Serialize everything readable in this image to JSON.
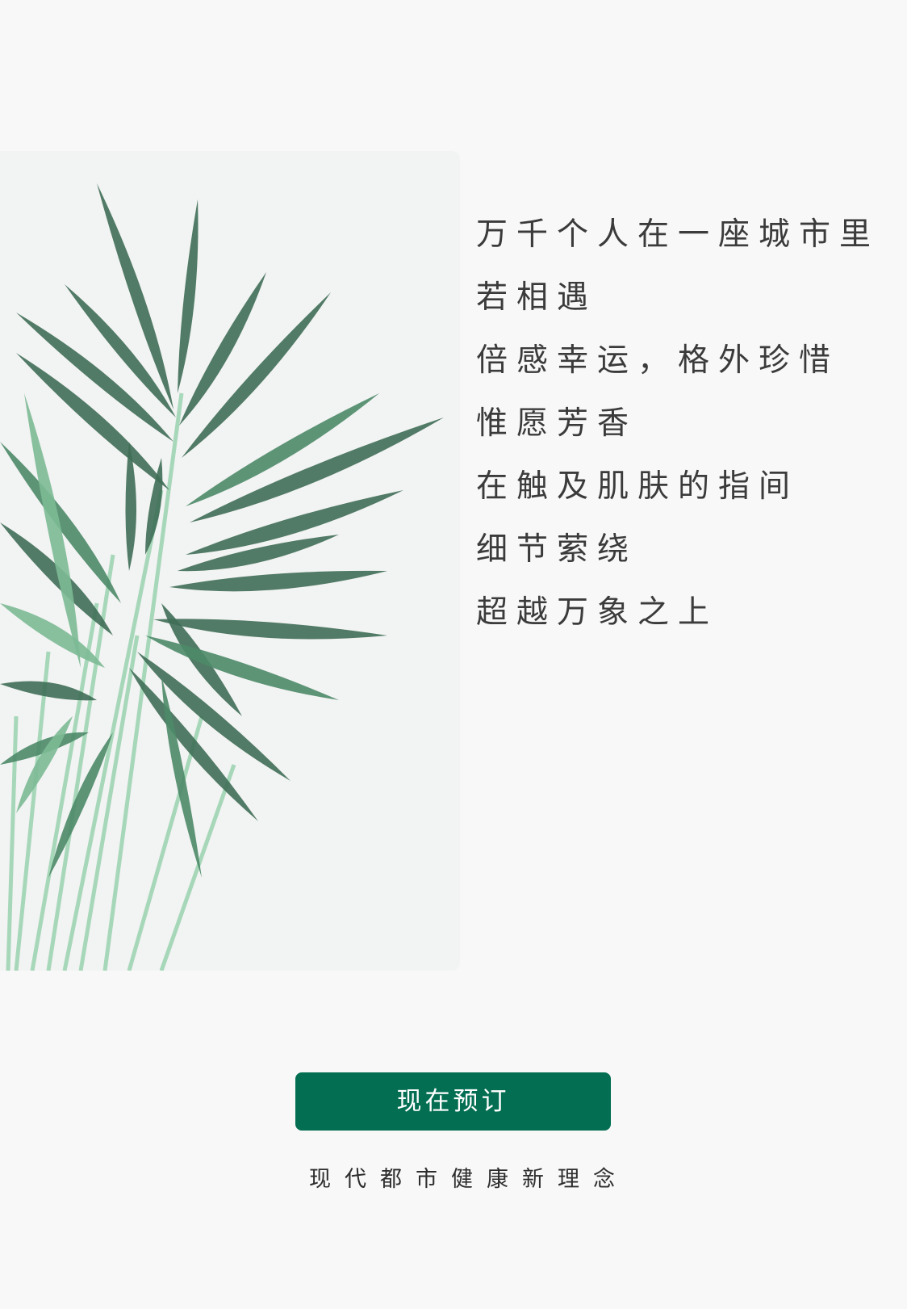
{
  "hero_image": {
    "subject": "potted palm plant with green fronds on a light background",
    "colors": {
      "background": "#f2f3f3",
      "leaf_dark": "#3f6e57",
      "leaf_mid": "#4d8a68",
      "leaf_light": "#7cba95",
      "stem": "#9bd3b0"
    }
  },
  "poem": {
    "lines": [
      "万千个人在一座城市里",
      "若相遇",
      "倍感幸运，格外珍惜",
      "惟愿芳香",
      "在触及肌肤的指间",
      "细节萦绕",
      "超越万象之上"
    ]
  },
  "cta": {
    "label": "现在预订",
    "color": "#036e52"
  },
  "tagline": "现代都市健康新理念"
}
